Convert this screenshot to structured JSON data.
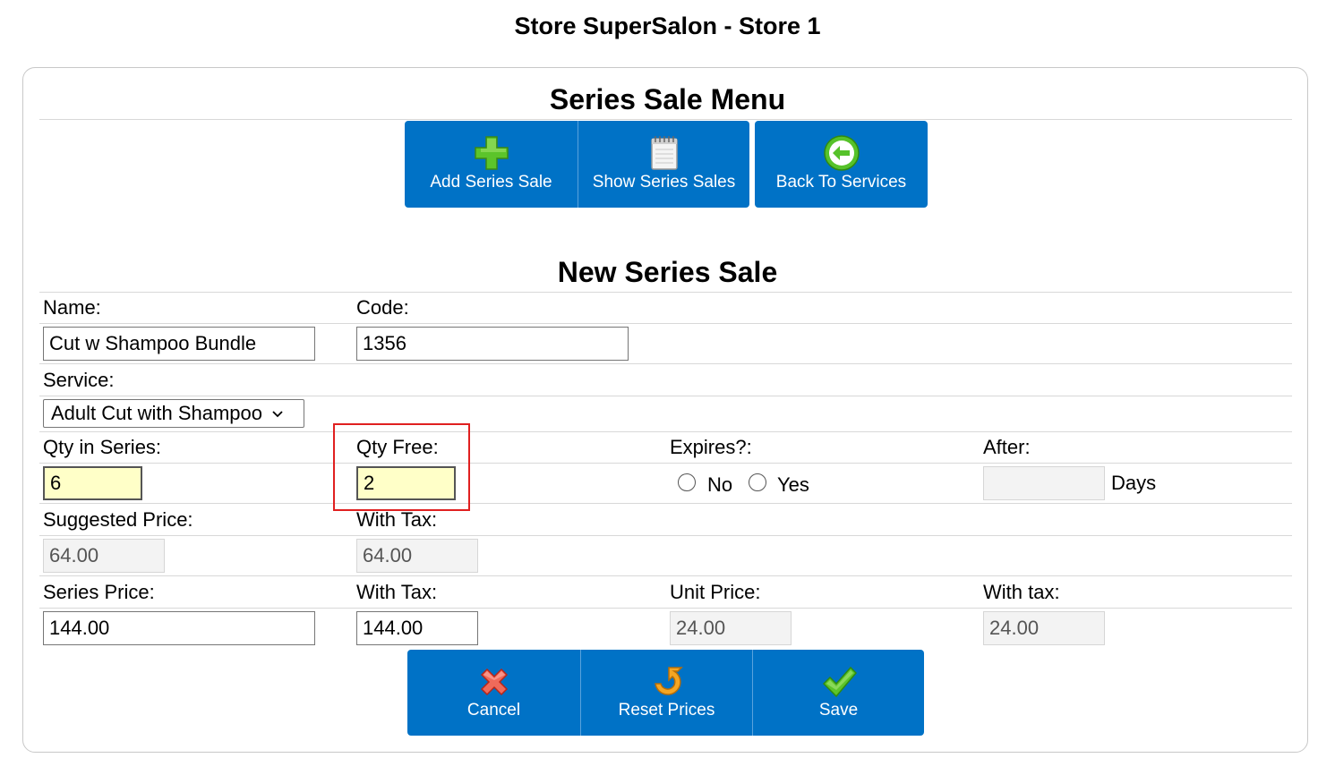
{
  "header": {
    "store_title": "Store SuperSalon - Store 1"
  },
  "menu": {
    "title": "Series Sale Menu",
    "buttons": {
      "add": "Add Series Sale",
      "show": "Show Series Sales",
      "back": "Back To Services"
    }
  },
  "form": {
    "title": "New Series Sale",
    "name_label": "Name:",
    "name_value": "Cut w Shampoo Bundle",
    "code_label": "Code:",
    "code_value": "1356",
    "service_label": "Service:",
    "service_value": "Adult Cut with Shampoo",
    "qty_series_label": "Qty in Series:",
    "qty_series_value": "6",
    "qty_free_label": "Qty Free:",
    "qty_free_value": "2",
    "expires_label": "Expires?:",
    "expires_no": "No",
    "expires_yes": "Yes",
    "after_label": "After:",
    "after_value": "",
    "days_label": "Days",
    "suggested_price_label": "Suggested Price:",
    "suggested_price_value": "64.00",
    "suggested_tax_label": "With Tax:",
    "suggested_tax_value": "64.00",
    "series_price_label": "Series Price:",
    "series_price_value": "144.00",
    "series_tax_label": "With Tax:",
    "series_tax_value": "144.00",
    "unit_price_label": "Unit Price:",
    "unit_price_value": "24.00",
    "unit_tax_label": "With tax:",
    "unit_tax_value": "24.00"
  },
  "actions": {
    "cancel": "Cancel",
    "reset": "Reset Prices",
    "save": "Save"
  },
  "colors": {
    "button_blue": "#0072c6",
    "highlight_field": "#ffffc8",
    "annotation_red": "#e02020"
  }
}
